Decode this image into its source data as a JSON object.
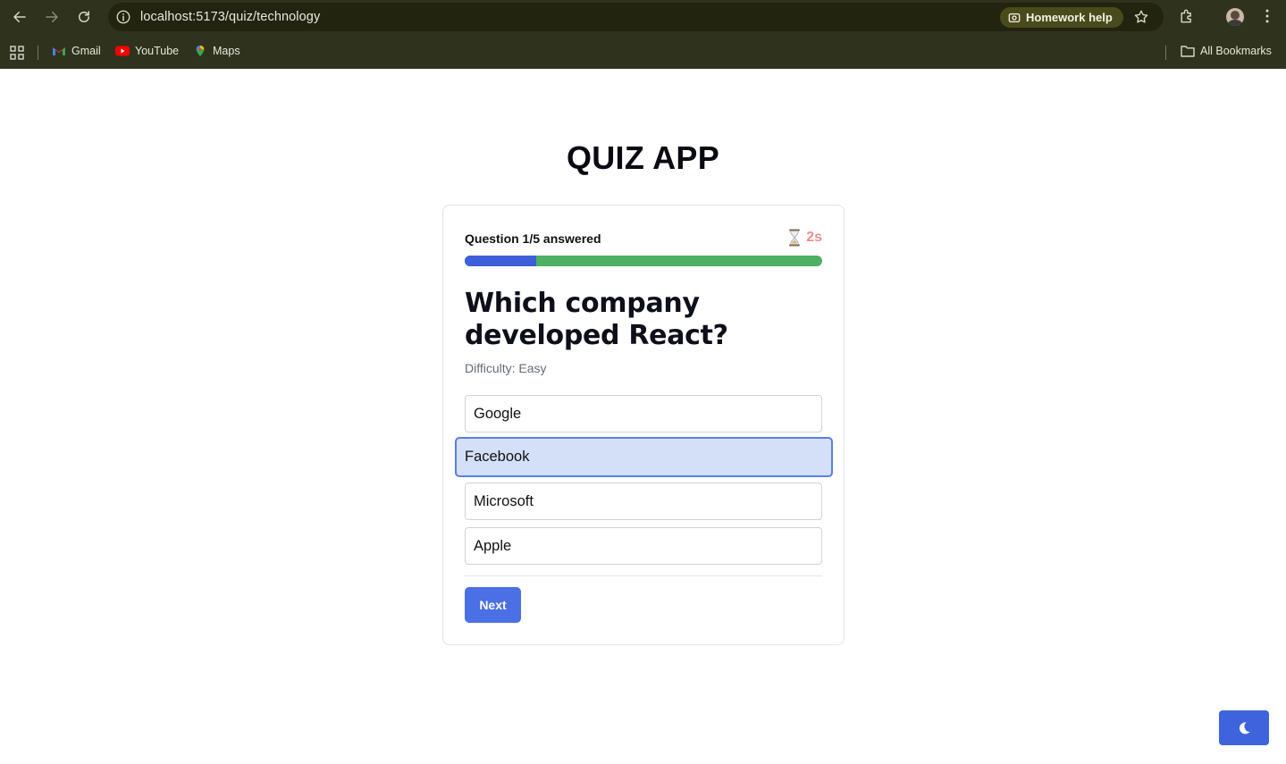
{
  "browser": {
    "url": "localhost:5173/quiz/technology",
    "homework_label": "Homework help",
    "bookmarks": [
      {
        "label": "Gmail",
        "icon": "gmail-icon"
      },
      {
        "label": "YouTube",
        "icon": "youtube-icon"
      },
      {
        "label": "Maps",
        "icon": "maps-icon"
      }
    ],
    "all_bookmarks_label": "All Bookmarks"
  },
  "page": {
    "title": "QUIZ APP"
  },
  "quiz": {
    "status": "Question 1/5 answered",
    "timer_icon": "hourglass-icon",
    "timer": "2s",
    "progress": 0.2,
    "question": "Which company developed React?",
    "difficulty": "Difficulty: Easy",
    "options": [
      "Google",
      "Facebook",
      "Microsoft",
      "Apple"
    ],
    "selected_option": "Facebook",
    "next_label": "Next"
  },
  "theme_toggle_icon": "moon-icon",
  "colors": {
    "chrome_bg": "#2f321d",
    "progress_filled": "#3d5fd9",
    "progress_remaining": "#4db063",
    "timer_text": "#e8908d",
    "selected_bg": "#d4e0f8",
    "selected_border": "#5b7fe0",
    "primary_button": "#4b6fe4"
  }
}
